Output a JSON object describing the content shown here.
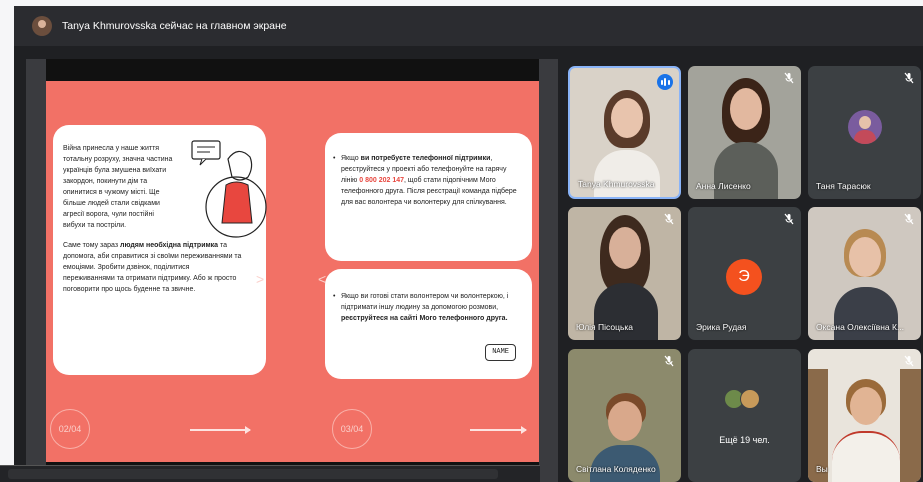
{
  "topbar": {
    "title": "Tanya Khmurovsska сейчас на главном экране"
  },
  "slide": {
    "card1": {
      "text1": "Війна принесла у наше життя тотальну розруху, значна частина українців була змушена виїхати закордон, покинути дім та опинитися в чужому місті. Ще більше людей стали свідками агресії ворога, чули постійні вибухи та постріли.",
      "text2_pre": "Саме тому зараз ",
      "text2_bold": "людям необхідна підтримка",
      "text2_post": " та допомога, аби справитися зі своїми переживаннями та емоціями. Зробити дзвінок, поділитися переживаннями та отримати підтримку. Або ж просто поговорити про щось буденне та звичне."
    },
    "card2": {
      "pre": "Якщо ",
      "bold1": "ви потребуєте телефонної підтримки",
      "mid": ", реєструйтеся у проекті або телефонуйте на гарячу лінію ",
      "phone": "0 800 202 147",
      "post": ", щоб стати підопічним Мого телефонного друга. Після реєстрації команда підбере для вас волонтера чи волонтерку для спілкування."
    },
    "card3": {
      "pre": "Якщо ви готові стати волонтером чи волонтеркою, і підтримати іншу людину за допомогою розмови, ",
      "bold": "реєструйтеся на сайті Мого телефонного друга.",
      "name_box": "NAME"
    },
    "page_left": "02/04",
    "page_right": "03/04"
  },
  "participants": [
    {
      "name": "Tanya Khmurovsska",
      "speaking": true
    },
    {
      "name": "Анна Лисенко",
      "muted": true
    },
    {
      "name": "Таня Тарасюк",
      "muted": true
    },
    {
      "name": "Юлія Пісоцька",
      "muted": true
    },
    {
      "name": "Эрика Рудая",
      "initial": "Э",
      "muted": true
    },
    {
      "name": "Оксана Олексіївна К...",
      "muted": true
    },
    {
      "name": "Світлана Коляденко",
      "muted": true
    },
    {
      "name": "Ещё 19 чел."
    },
    {
      "name": "Вы",
      "muted": true
    }
  ],
  "colors": {
    "slide_bg": "#f27166",
    "accent": "#1a73e8",
    "avatar_orange": "#f4511e"
  }
}
